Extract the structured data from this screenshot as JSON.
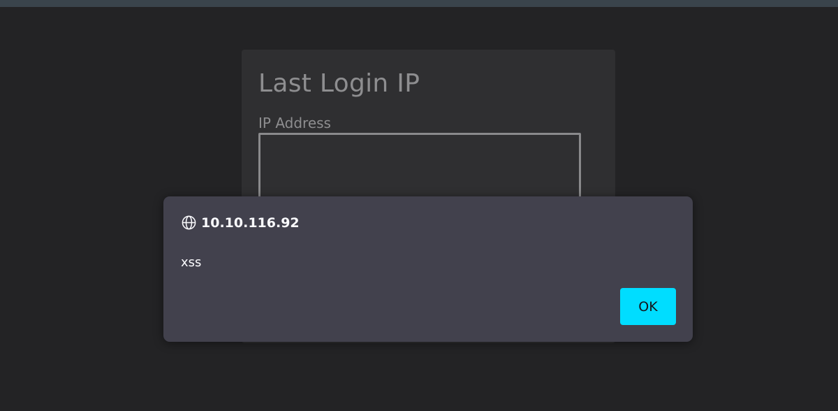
{
  "page": {
    "background": "#232325"
  },
  "card": {
    "title": "Last Login IP",
    "field_label": "IP Address",
    "field_value": ""
  },
  "alert_dialog": {
    "origin": "10.10.116.92",
    "origin_icon": "globe-icon",
    "message": "xss",
    "ok_label": "OK",
    "accent_color": "#00ddff"
  }
}
